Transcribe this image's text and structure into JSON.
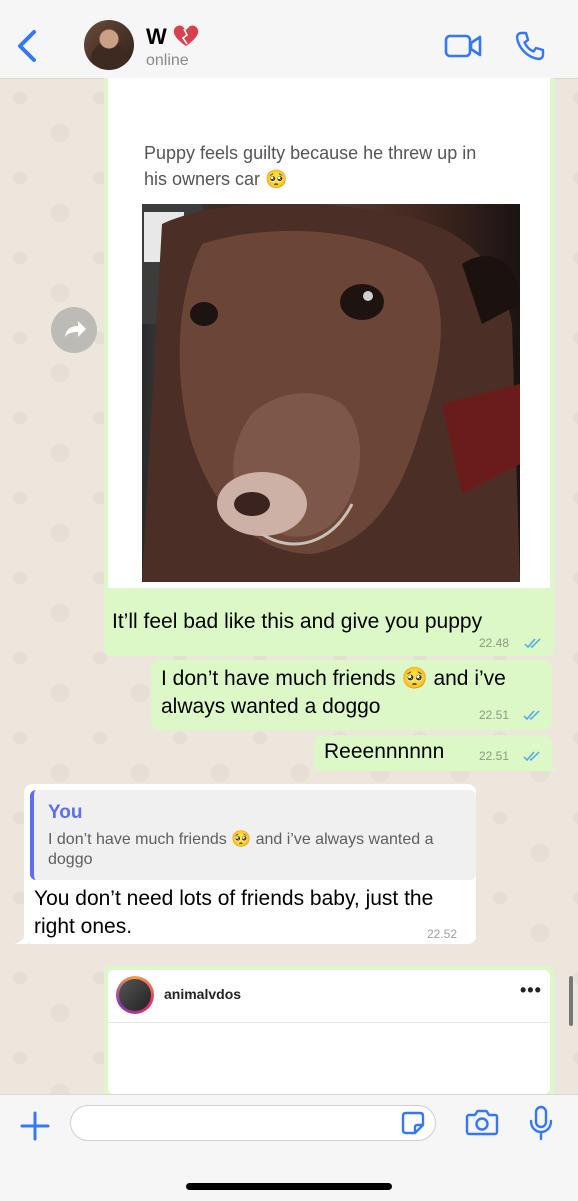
{
  "header": {
    "contact_name": "W",
    "status": "online"
  },
  "messages": {
    "shared_post": {
      "caption": "Puppy feels guilty because he threw up in his owners car 🥺",
      "text": "It’ll feel bad like this and give you puppy",
      "time": "22.48"
    },
    "friends": {
      "text": "I don’t have much friends 🥺  and i’ve always wanted a doggo",
      "time": "22.51"
    },
    "reee": {
      "text": "Reeennnnnn",
      "time": "22.51"
    },
    "reply": {
      "quote_author": "You",
      "quote_text": "I don’t have much friends 🥺  and i’ve always wanted a doggo",
      "text": "You don’t need lots of friends baby, just the right ones.",
      "time": "22.52"
    },
    "insta": {
      "account": "animalvdos",
      "more": "•••"
    }
  },
  "composer": {
    "placeholder": ""
  },
  "colors": {
    "accent": "#3478f6",
    "outgoing_bubble": "#dcf8c6",
    "read_ticks": "#4fa9e8",
    "quote_bar": "#5b6ef5"
  },
  "icons": [
    "back-chevron-icon",
    "heart-icon",
    "video-call-icon",
    "phone-icon",
    "forward-icon",
    "plus-icon",
    "sticker-icon",
    "camera-icon",
    "mic-icon"
  ]
}
